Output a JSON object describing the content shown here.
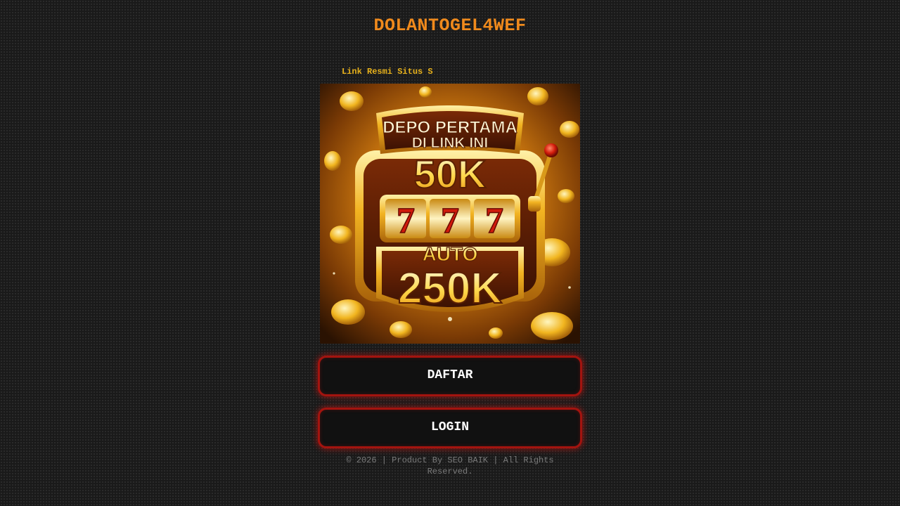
{
  "header": {
    "title": "DOLANTOGEL4WEF"
  },
  "marquee": {
    "text": "Link Resmi Situs S"
  },
  "banner": {
    "line1": "DEPO PERTAMA",
    "line2": "DI LINK INI",
    "amount": "50K",
    "reels": [
      "7",
      "7",
      "7"
    ],
    "auto_label": "AUTO",
    "bonus": "250K"
  },
  "buttons": {
    "register_label": "DAFTAR",
    "login_label": "LOGIN"
  },
  "footer": {
    "text": "© 2026 | Product By SEO BAIK | All Rights Reserved."
  },
  "colors": {
    "title": "#f08a1c",
    "marquee": "#e8b21c",
    "button_border": "#a3140f",
    "button_bg": "#111111",
    "page_bg": "#1a1a1a"
  }
}
